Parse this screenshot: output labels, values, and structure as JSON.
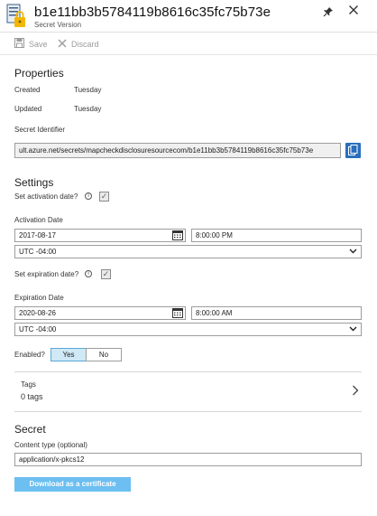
{
  "header": {
    "title": "b1e11bb3b5784119b8616c35fc75b73e",
    "subtitle": "Secret Version",
    "icon": "key-vault-secret-icon",
    "pin_icon": "pin-icon",
    "close_icon": "close-icon"
  },
  "toolbar": {
    "save_label": "Save",
    "discard_label": "Discard",
    "save_icon": "floppy-disk-icon",
    "discard_icon": "x-icon"
  },
  "properties": {
    "heading": "Properties",
    "created_label": "Created",
    "created_value": "Tuesday",
    "updated_label": "Updated",
    "updated_value": "Tuesday",
    "secret_identifier_label": "Secret Identifier",
    "secret_identifier_value": "ult.azure.net/secrets/mapcheckdisclosuresourcecom/b1e11bb3b5784119b8616c35fc75b73e",
    "copy_icon": "copy-icon"
  },
  "settings": {
    "heading": "Settings",
    "set_activation_label": "Set activation date?",
    "activation_checked": true,
    "activation_date_label": "Activation Date",
    "activation_date": "2017-08-17",
    "activation_time": "8:00:00 PM",
    "activation_timezone": "UTC -04:00",
    "set_expiration_label": "Set expiration date?",
    "expiration_checked": true,
    "expiration_date_label": "Expiration Date",
    "expiration_date": "2020-08-26",
    "expiration_time": "8:00:00 AM",
    "expiration_timezone": "UTC -04:00",
    "enabled_label": "Enabled?",
    "enabled_yes": "Yes",
    "enabled_no": "No",
    "enabled_selected": "Yes",
    "info_icon": "info-icon",
    "calendar_icon": "calendar-icon",
    "dropdown_icon": "chevron-down-icon"
  },
  "tags": {
    "label": "Tags",
    "value": "0 tags",
    "chevron_icon": "chevron-right-icon"
  },
  "secret": {
    "heading": "Secret",
    "content_type_label": "Content type (optional)",
    "content_type_value": "application/x-pkcs12",
    "download_label": "Download as a certificate"
  },
  "colors": {
    "accent": "#2a6fbd",
    "toggle_on": "#cfe9f6",
    "download_button": "#6cbff0",
    "key_gold": "#f2b705"
  }
}
